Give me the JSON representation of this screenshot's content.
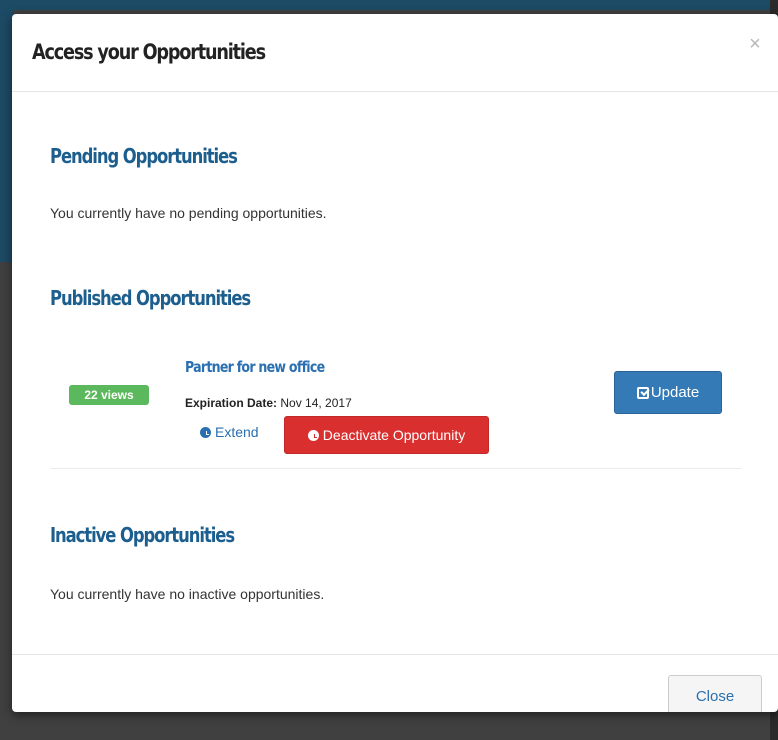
{
  "modal": {
    "title": "Access your Opportunities",
    "close_symbol": "×"
  },
  "pending": {
    "heading": "Pending Opportunities",
    "message": "You currently have no pending opportunities."
  },
  "published": {
    "heading": "Published Opportunities",
    "items": [
      {
        "views": "22 views",
        "title": "Partner for new office",
        "expiration_label": "Expiration Date:",
        "expiration_value": "Nov 14, 2017",
        "extend_label": "Extend",
        "deactivate_label": "Deactivate Opportunity",
        "update_label": "Update"
      }
    ]
  },
  "inactive": {
    "heading": "Inactive Opportunities",
    "message": "You currently have no inactive opportunities."
  },
  "footer": {
    "close_label": "Close"
  },
  "colors": {
    "heading": "#1c5e8e",
    "link": "#2a6fb0",
    "badge": "#5cb85c",
    "primary": "#337ab7",
    "danger": "#d9302f"
  },
  "icons": {
    "clock": "clock-icon",
    "edit": "edit-icon",
    "close": "close-icon"
  }
}
